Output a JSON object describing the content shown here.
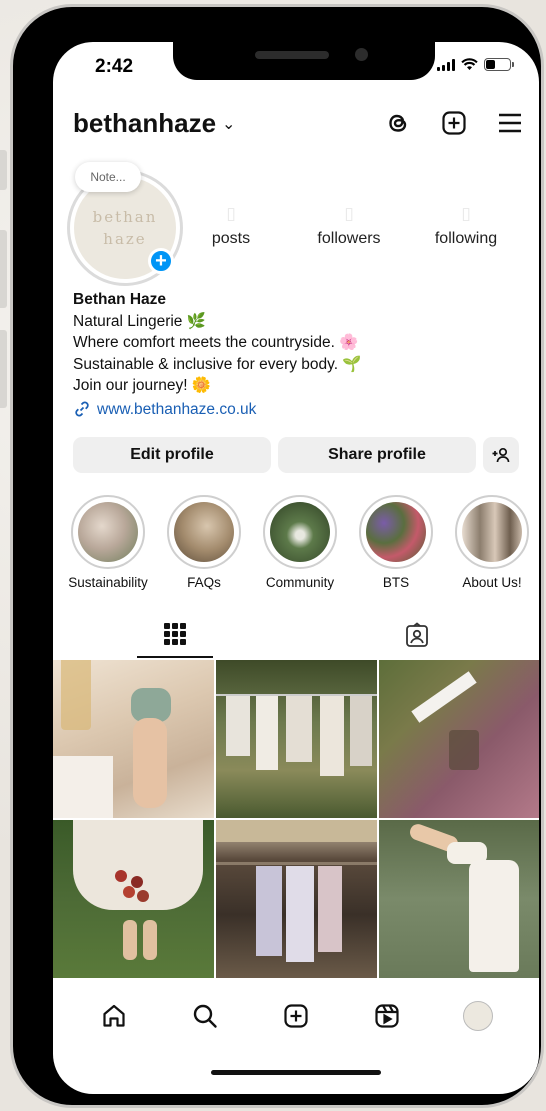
{
  "status": {
    "time": "2:42"
  },
  "profile": {
    "username": "bethanhaze",
    "chevron": "⌄",
    "note": "Note...",
    "avatar_text_1": "bethan",
    "avatar_text_2": "haze",
    "add_badge": "+",
    "stats": [
      {
        "label": "posts"
      },
      {
        "label": "followers"
      },
      {
        "label": "following"
      }
    ],
    "bio": {
      "name": "Bethan Haze",
      "lines": [
        "Natural Lingerie 🌿",
        "Where comfort meets the countryside. 🌸",
        "Sustainable & inclusive for every body. 🌱",
        "Join our journey! 🌼"
      ],
      "link": "www.bethanhaze.co.uk"
    },
    "buttons": {
      "edit": "Edit profile",
      "share": "Share profile"
    }
  },
  "highlights": [
    {
      "label": "Sustainability",
      "color": "#b9a89a"
    },
    {
      "label": "FAQs",
      "color": "#a38b6d"
    },
    {
      "label": "Community",
      "color": "#5d7a4a"
    },
    {
      "label": "BTS",
      "color": "#5a6e3f"
    },
    {
      "label": "About Us!",
      "color": "#8c7e6e"
    }
  ],
  "tabs": [
    {
      "icon": "grid-icon",
      "active": true
    },
    {
      "icon": "tagged-icon",
      "active": false
    }
  ],
  "posts": [
    {
      "desc": "bathroom-towel",
      "color": "#d9c6b0"
    },
    {
      "desc": "clothesline",
      "color": "#6d7a4e"
    },
    {
      "desc": "botanical-dye",
      "color": "#8a5a6a"
    },
    {
      "desc": "apples-in-skirt",
      "color": "#4d6b36"
    },
    {
      "desc": "vintage-rack",
      "color": "#5a4a3c"
    },
    {
      "desc": "green-door",
      "color": "#7a8a6a"
    }
  ],
  "nav": [
    {
      "icon": "home-icon"
    },
    {
      "icon": "search-icon"
    },
    {
      "icon": "create-icon"
    },
    {
      "icon": "reels-icon"
    },
    {
      "icon": "profile-avatar"
    }
  ]
}
